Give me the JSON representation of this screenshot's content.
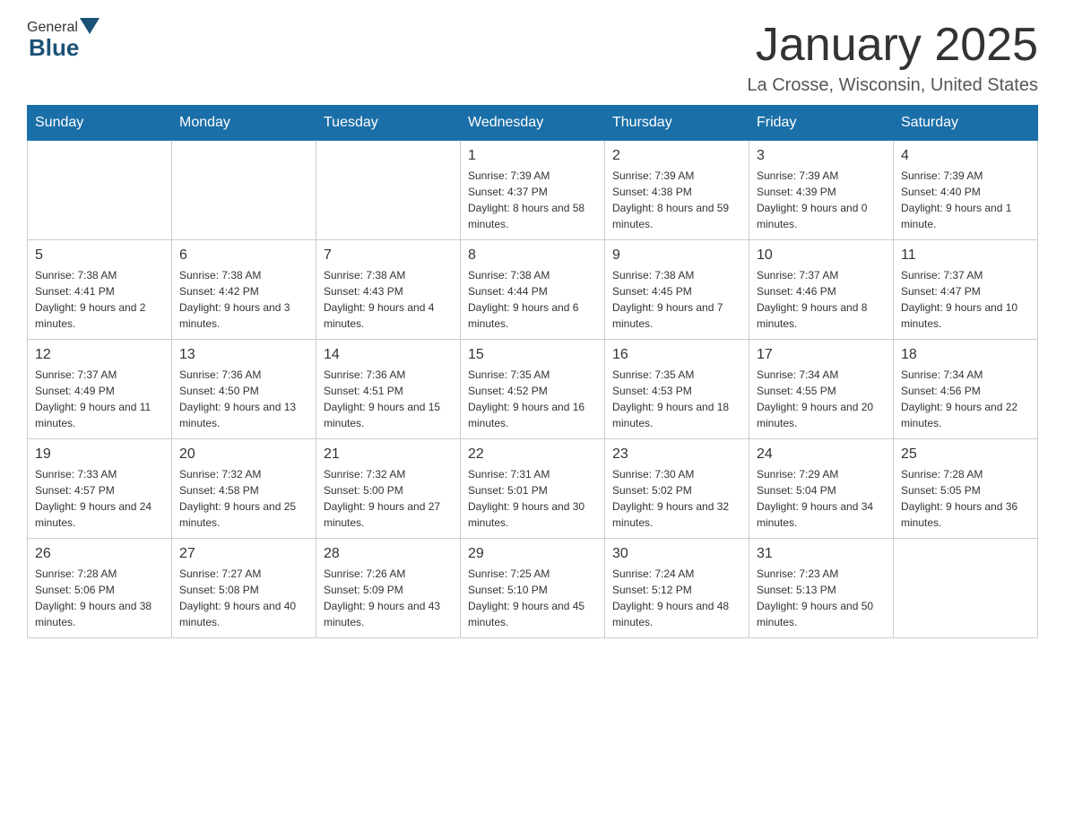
{
  "header": {
    "logo_general": "General",
    "logo_blue": "Blue",
    "month_title": "January 2025",
    "location": "La Crosse, Wisconsin, United States"
  },
  "weekdays": [
    "Sunday",
    "Monday",
    "Tuesday",
    "Wednesday",
    "Thursday",
    "Friday",
    "Saturday"
  ],
  "weeks": [
    [
      {
        "day": "",
        "sunrise": "",
        "sunset": "",
        "daylight": ""
      },
      {
        "day": "",
        "sunrise": "",
        "sunset": "",
        "daylight": ""
      },
      {
        "day": "",
        "sunrise": "",
        "sunset": "",
        "daylight": ""
      },
      {
        "day": "1",
        "sunrise": "Sunrise: 7:39 AM",
        "sunset": "Sunset: 4:37 PM",
        "daylight": "Daylight: 8 hours and 58 minutes."
      },
      {
        "day": "2",
        "sunrise": "Sunrise: 7:39 AM",
        "sunset": "Sunset: 4:38 PM",
        "daylight": "Daylight: 8 hours and 59 minutes."
      },
      {
        "day": "3",
        "sunrise": "Sunrise: 7:39 AM",
        "sunset": "Sunset: 4:39 PM",
        "daylight": "Daylight: 9 hours and 0 minutes."
      },
      {
        "day": "4",
        "sunrise": "Sunrise: 7:39 AM",
        "sunset": "Sunset: 4:40 PM",
        "daylight": "Daylight: 9 hours and 1 minute."
      }
    ],
    [
      {
        "day": "5",
        "sunrise": "Sunrise: 7:38 AM",
        "sunset": "Sunset: 4:41 PM",
        "daylight": "Daylight: 9 hours and 2 minutes."
      },
      {
        "day": "6",
        "sunrise": "Sunrise: 7:38 AM",
        "sunset": "Sunset: 4:42 PM",
        "daylight": "Daylight: 9 hours and 3 minutes."
      },
      {
        "day": "7",
        "sunrise": "Sunrise: 7:38 AM",
        "sunset": "Sunset: 4:43 PM",
        "daylight": "Daylight: 9 hours and 4 minutes."
      },
      {
        "day": "8",
        "sunrise": "Sunrise: 7:38 AM",
        "sunset": "Sunset: 4:44 PM",
        "daylight": "Daylight: 9 hours and 6 minutes."
      },
      {
        "day": "9",
        "sunrise": "Sunrise: 7:38 AM",
        "sunset": "Sunset: 4:45 PM",
        "daylight": "Daylight: 9 hours and 7 minutes."
      },
      {
        "day": "10",
        "sunrise": "Sunrise: 7:37 AM",
        "sunset": "Sunset: 4:46 PM",
        "daylight": "Daylight: 9 hours and 8 minutes."
      },
      {
        "day": "11",
        "sunrise": "Sunrise: 7:37 AM",
        "sunset": "Sunset: 4:47 PM",
        "daylight": "Daylight: 9 hours and 10 minutes."
      }
    ],
    [
      {
        "day": "12",
        "sunrise": "Sunrise: 7:37 AM",
        "sunset": "Sunset: 4:49 PM",
        "daylight": "Daylight: 9 hours and 11 minutes."
      },
      {
        "day": "13",
        "sunrise": "Sunrise: 7:36 AM",
        "sunset": "Sunset: 4:50 PM",
        "daylight": "Daylight: 9 hours and 13 minutes."
      },
      {
        "day": "14",
        "sunrise": "Sunrise: 7:36 AM",
        "sunset": "Sunset: 4:51 PM",
        "daylight": "Daylight: 9 hours and 15 minutes."
      },
      {
        "day": "15",
        "sunrise": "Sunrise: 7:35 AM",
        "sunset": "Sunset: 4:52 PM",
        "daylight": "Daylight: 9 hours and 16 minutes."
      },
      {
        "day": "16",
        "sunrise": "Sunrise: 7:35 AM",
        "sunset": "Sunset: 4:53 PM",
        "daylight": "Daylight: 9 hours and 18 minutes."
      },
      {
        "day": "17",
        "sunrise": "Sunrise: 7:34 AM",
        "sunset": "Sunset: 4:55 PM",
        "daylight": "Daylight: 9 hours and 20 minutes."
      },
      {
        "day": "18",
        "sunrise": "Sunrise: 7:34 AM",
        "sunset": "Sunset: 4:56 PM",
        "daylight": "Daylight: 9 hours and 22 minutes."
      }
    ],
    [
      {
        "day": "19",
        "sunrise": "Sunrise: 7:33 AM",
        "sunset": "Sunset: 4:57 PM",
        "daylight": "Daylight: 9 hours and 24 minutes."
      },
      {
        "day": "20",
        "sunrise": "Sunrise: 7:32 AM",
        "sunset": "Sunset: 4:58 PM",
        "daylight": "Daylight: 9 hours and 25 minutes."
      },
      {
        "day": "21",
        "sunrise": "Sunrise: 7:32 AM",
        "sunset": "Sunset: 5:00 PM",
        "daylight": "Daylight: 9 hours and 27 minutes."
      },
      {
        "day": "22",
        "sunrise": "Sunrise: 7:31 AM",
        "sunset": "Sunset: 5:01 PM",
        "daylight": "Daylight: 9 hours and 30 minutes."
      },
      {
        "day": "23",
        "sunrise": "Sunrise: 7:30 AM",
        "sunset": "Sunset: 5:02 PM",
        "daylight": "Daylight: 9 hours and 32 minutes."
      },
      {
        "day": "24",
        "sunrise": "Sunrise: 7:29 AM",
        "sunset": "Sunset: 5:04 PM",
        "daylight": "Daylight: 9 hours and 34 minutes."
      },
      {
        "day": "25",
        "sunrise": "Sunrise: 7:28 AM",
        "sunset": "Sunset: 5:05 PM",
        "daylight": "Daylight: 9 hours and 36 minutes."
      }
    ],
    [
      {
        "day": "26",
        "sunrise": "Sunrise: 7:28 AM",
        "sunset": "Sunset: 5:06 PM",
        "daylight": "Daylight: 9 hours and 38 minutes."
      },
      {
        "day": "27",
        "sunrise": "Sunrise: 7:27 AM",
        "sunset": "Sunset: 5:08 PM",
        "daylight": "Daylight: 9 hours and 40 minutes."
      },
      {
        "day": "28",
        "sunrise": "Sunrise: 7:26 AM",
        "sunset": "Sunset: 5:09 PM",
        "daylight": "Daylight: 9 hours and 43 minutes."
      },
      {
        "day": "29",
        "sunrise": "Sunrise: 7:25 AM",
        "sunset": "Sunset: 5:10 PM",
        "daylight": "Daylight: 9 hours and 45 minutes."
      },
      {
        "day": "30",
        "sunrise": "Sunrise: 7:24 AM",
        "sunset": "Sunset: 5:12 PM",
        "daylight": "Daylight: 9 hours and 48 minutes."
      },
      {
        "day": "31",
        "sunrise": "Sunrise: 7:23 AM",
        "sunset": "Sunset: 5:13 PM",
        "daylight": "Daylight: 9 hours and 50 minutes."
      },
      {
        "day": "",
        "sunrise": "",
        "sunset": "",
        "daylight": ""
      }
    ]
  ]
}
